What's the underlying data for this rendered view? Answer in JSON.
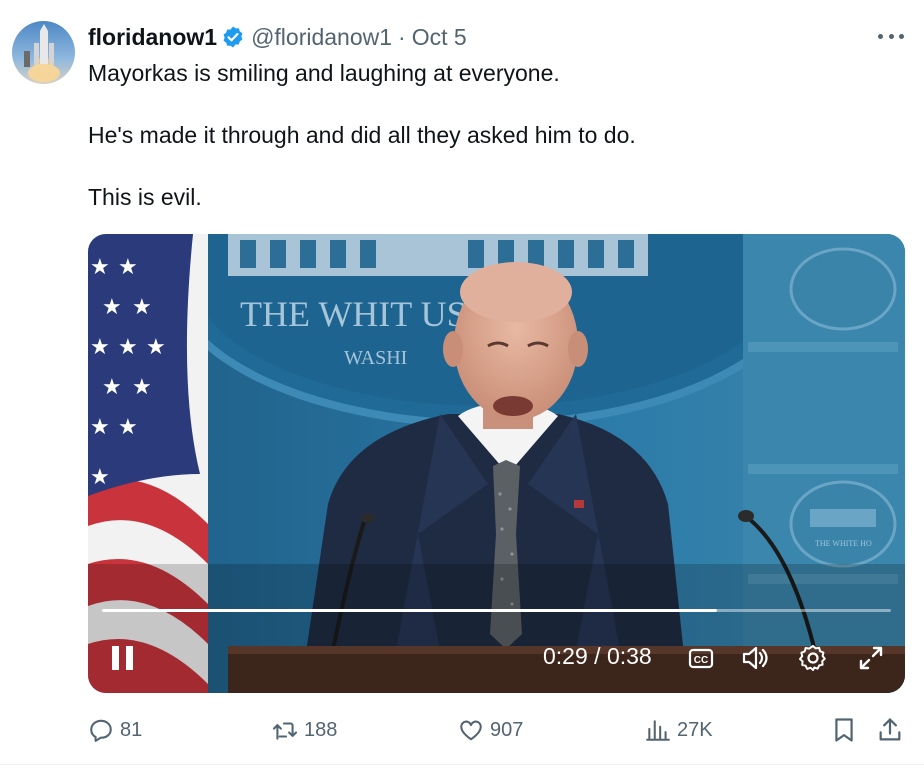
{
  "tweet": {
    "display_name": "floridanow1",
    "handle": "@floridanow1",
    "separator": "·",
    "date": "Oct 5",
    "paragraphs": [
      "Mayorkas is smiling and laughing at everyone.",
      "He's made it through and did all they asked him to do.",
      "This is evil."
    ]
  },
  "video": {
    "backdrop_text_1": "THE WHIT   USE",
    "backdrop_text_2": "WASHI",
    "small_seal_text": "THE WHITE HO",
    "elapsed": "0:29",
    "duration": "0:38",
    "time_separator": "/",
    "progress": 0.78,
    "controls": [
      "pause-icon",
      "closed-captions-icon",
      "volume-icon",
      "settings-icon",
      "fullscreen-icon"
    ]
  },
  "metrics": {
    "replies": "81",
    "reposts": "188",
    "likes": "907",
    "views": "27K"
  },
  "colors": {
    "text_primary": "#0f1419",
    "text_secondary": "#536471",
    "verified_badge": "#1d9bf0"
  }
}
